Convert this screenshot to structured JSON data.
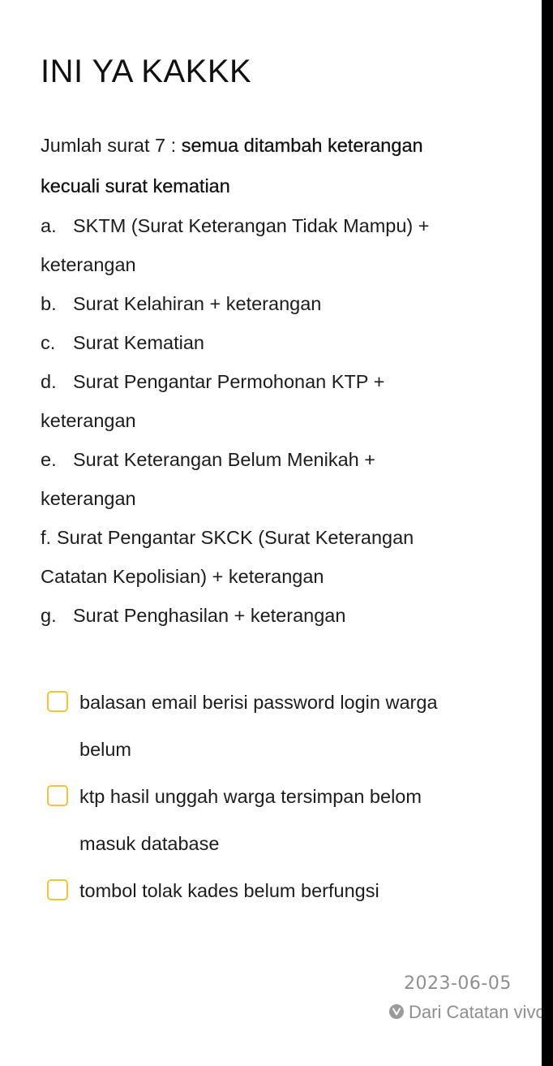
{
  "note": {
    "title": "INI YA KAKKK",
    "intro_prefix": "Jumlah surat 7 : ",
    "intro_bold_1": "semua ditambah keterangan",
    "intro_bold_2": "kecuali surat kematian",
    "items": [
      {
        "marker": "a.",
        "text": "SKTM (Surat Keterangan Tidak Mampu) +",
        "cont": "keterangan"
      },
      {
        "marker": "b.",
        "text": "Surat Kelahiran + keterangan"
      },
      {
        "marker": "c.",
        "text": "Surat Kematian"
      },
      {
        "marker": "d.",
        "text": "Surat Pengantar Permohonan KTP +",
        "cont": "keterangan"
      },
      {
        "marker": "e.",
        "text": "Surat Keterangan Belum Menikah +",
        "cont": "keterangan"
      },
      {
        "marker": "f.",
        "text": "Surat Pengantar SKCK (Surat Keterangan",
        "cont": "Catatan Kepolisian) + keterangan"
      },
      {
        "marker": "g.",
        "text": "Surat Penghasilan + keterangan"
      }
    ]
  },
  "checklist": [
    {
      "line1": "balasan email berisi password login warga",
      "line2": "belum",
      "checked": false
    },
    {
      "line1": "ktp hasil unggah warga tersimpan belom",
      "line2": "masuk database",
      "checked": false
    },
    {
      "line1": "tombol tolak kades belum berfungsi",
      "checked": false
    }
  ],
  "footer": {
    "date": "2023-06-05",
    "source": "Dari Catatan vivo",
    "source_icon": "vivo-logo-icon"
  },
  "colors": {
    "checkbox_border": "#f2c43d",
    "meta_text": "#8e8e8e"
  }
}
